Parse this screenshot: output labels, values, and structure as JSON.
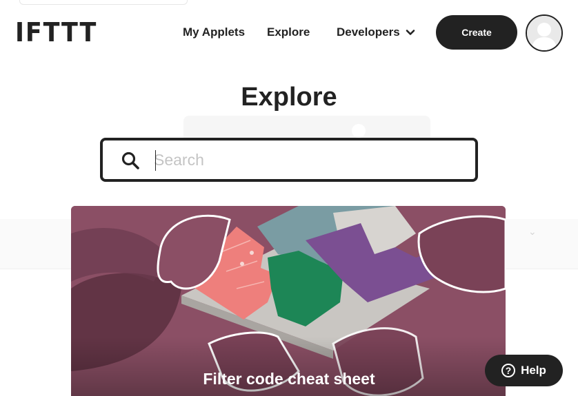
{
  "header": {
    "logo": "IFTTT",
    "nav": {
      "my_applets": "My Applets",
      "explore": "Explore",
      "developers": "Developers"
    },
    "create_label": "Create"
  },
  "main": {
    "title": "Explore",
    "search": {
      "placeholder": "Search",
      "value": ""
    },
    "featured_card": {
      "title": "Filter code cheat sheet"
    }
  },
  "help": {
    "label": "Help",
    "icon_glyph": "?"
  },
  "colors": {
    "text_dark": "#222222",
    "card_bg": "#8b4f65",
    "puzzle_pink": "#ee7f7c",
    "puzzle_green": "#1d8656",
    "puzzle_purple": "#7b4f92",
    "puzzle_teal": "#7a9ca3"
  }
}
